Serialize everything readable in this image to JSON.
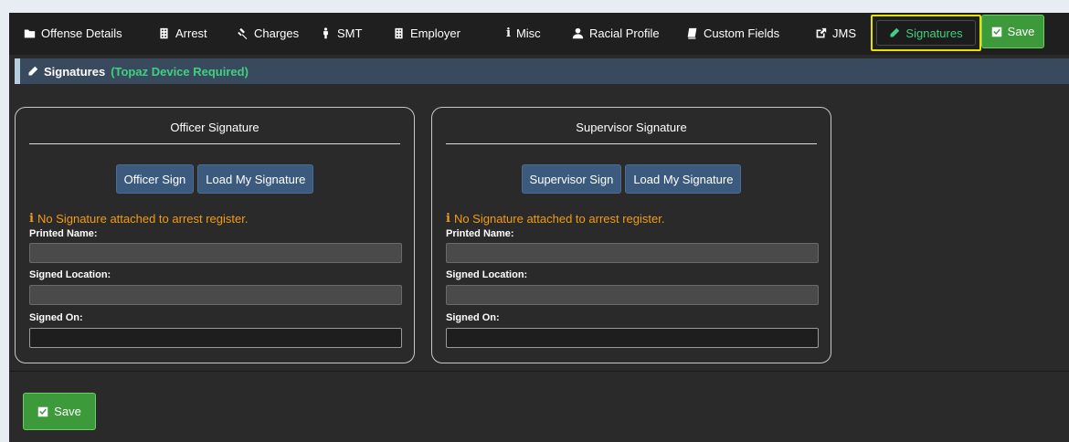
{
  "nav": {
    "items": [
      {
        "label": "Offense Details",
        "icon": "folder-icon"
      },
      {
        "label": "Arrest",
        "icon": "building-icon"
      },
      {
        "label": "Charges",
        "icon": "gavel-icon"
      },
      {
        "label": "SMT",
        "icon": "male-icon"
      },
      {
        "label": "Employer",
        "icon": "building-icon"
      },
      {
        "label": "Misc",
        "icon": "info-icon"
      },
      {
        "label": "Racial Profile",
        "icon": "user-icon"
      },
      {
        "label": "Custom Fields",
        "icon": "book-icon"
      },
      {
        "label": "JMS",
        "icon": "external-link-icon"
      }
    ],
    "active_tab": "Signatures",
    "save_label": "Save"
  },
  "section": {
    "title": "Signatures",
    "note": "(Topaz Device Required)"
  },
  "officer": {
    "title": "Officer Signature",
    "sign_button": "Officer Sign",
    "load_button": "Load My Signature",
    "warning": "No Signature attached to arrest register.",
    "printed_name_label": "Printed Name:",
    "printed_name": "",
    "signed_location_label": "Signed Location:",
    "signed_location": "",
    "signed_on_label": "Signed On:",
    "signed_on": ""
  },
  "supervisor": {
    "title": "Supervisor Signature",
    "sign_button": "Supervisor Sign",
    "load_button": "Load My Signature",
    "warning": "No Signature attached to arrest register.",
    "printed_name_label": "Printed Name:",
    "printed_name": "",
    "signed_location_label": "Signed Location:",
    "signed_location": "",
    "signed_on_label": "Signed On:",
    "signed_on": ""
  },
  "footer": {
    "save_label": "Save"
  },
  "colors": {
    "accent_green": "#3fd17f",
    "save_green": "#3d9a3b",
    "warning": "#f39c12",
    "button_blue": "#3c5a7e",
    "highlight_yellow": "#e5e100"
  }
}
